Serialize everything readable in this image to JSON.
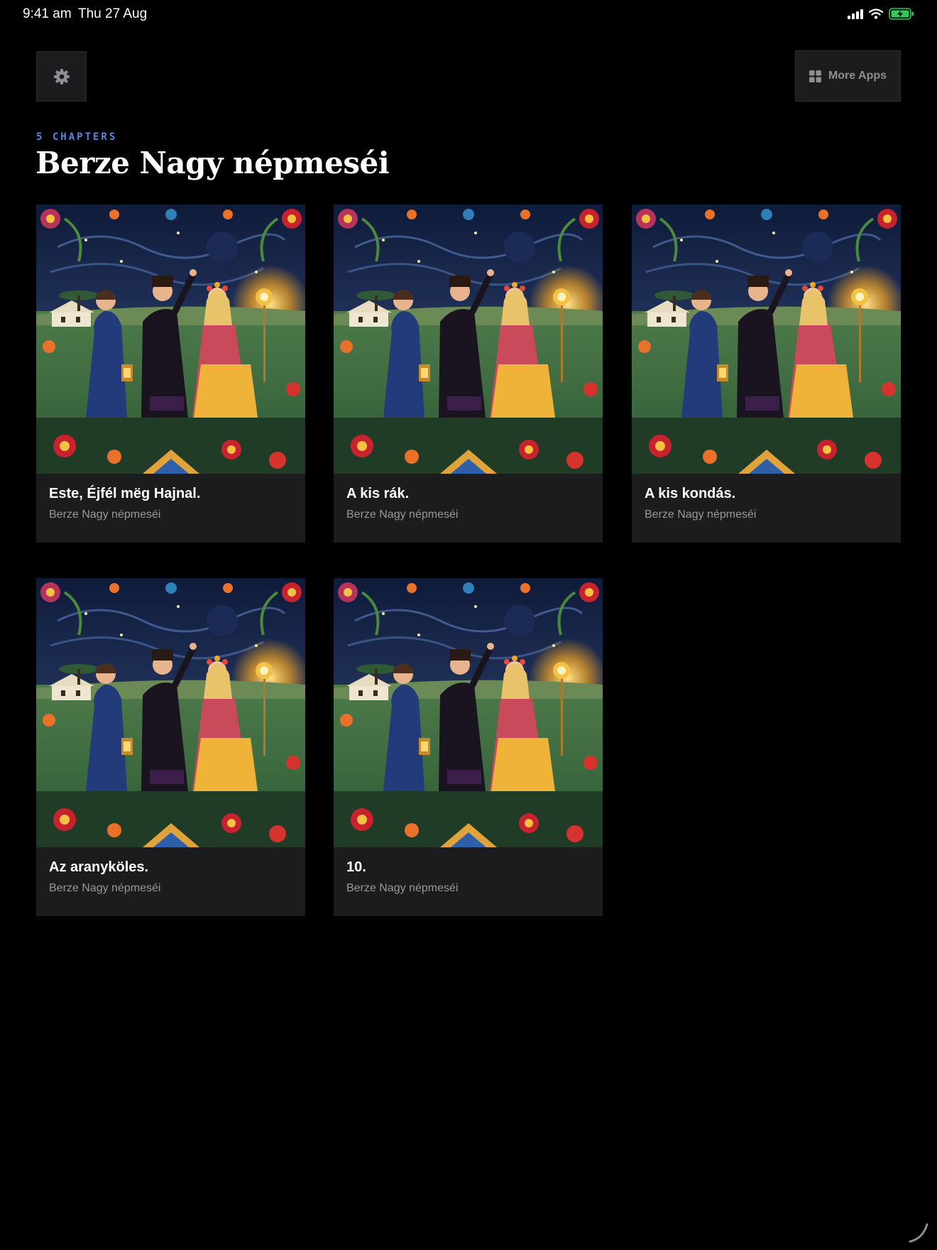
{
  "status_bar": {
    "time": "9:41 am",
    "date": "Thu 27 Aug"
  },
  "toolbar": {
    "more_apps_label": "More Apps"
  },
  "header": {
    "chapters_count": "5 CHAPTERS",
    "title": "Berze Nagy népmeséi"
  },
  "chapters": [
    {
      "title": "Este, Éjfél mëg Hajnal.",
      "subtitle": "Berze Nagy népmeséi"
    },
    {
      "title": "A kis rák.",
      "subtitle": "Berze Nagy népmeséi"
    },
    {
      "title": "A kis kondás.",
      "subtitle": "Berze Nagy népmeséi"
    },
    {
      "title": "Az aranyköles.",
      "subtitle": "Berze Nagy népmeséi"
    },
    {
      "title": "10.",
      "subtitle": "Berze Nagy népmeséi"
    }
  ],
  "colors": {
    "background": "#000000",
    "card": "#1c1c1e",
    "accent": "#5b86e5",
    "battery": "#34c759"
  },
  "icons": {
    "settings": "gear-icon",
    "more_apps": "grid-icon"
  }
}
